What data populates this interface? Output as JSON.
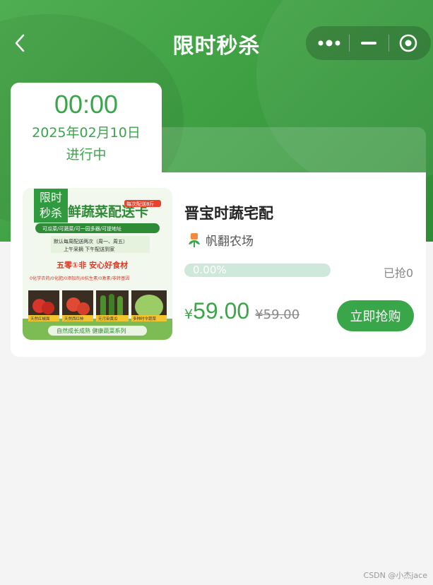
{
  "nav": {
    "title": "限时秒杀"
  },
  "timer": {
    "countdown": "00:00",
    "date": "2025年02月10日",
    "status": "进行中"
  },
  "product": {
    "badge_line1": "限时",
    "badge_line2": "秒杀",
    "image": {
      "title": "鲜蔬菜配送卡",
      "tag": "每次配送8斤",
      "slogan": "可瓜菜/可蔬菜/可一园多器/可提地址",
      "desc1": "默认每周配送两次（周一、周五）",
      "desc2": "上午采摘 下午配送到家",
      "feature": "五零①非 安心好食材",
      "feature2": "0化学农药/0化肥/0添加剂/0抗生素/0激素/非转基因",
      "items": [
        "天然红椒面",
        "天然西红柿",
        "无污染黄瓜",
        "多种时令蔬菜"
      ],
      "footer": "自然成长成熟 健康蔬菜系列"
    },
    "name": "晋宝时蔬宅配",
    "farm": "帆翻农场",
    "progress": 0.0,
    "progress_text": "0.00%",
    "sold_text": "已抢0",
    "currency": "¥",
    "price": "59.00",
    "original_price": "¥59.00",
    "buy_label": "立即抢购"
  },
  "watermark": "CSDN @小杰jace",
  "colors": {
    "primary": "#3aa64a",
    "progress_track": "#cfe8dc"
  }
}
